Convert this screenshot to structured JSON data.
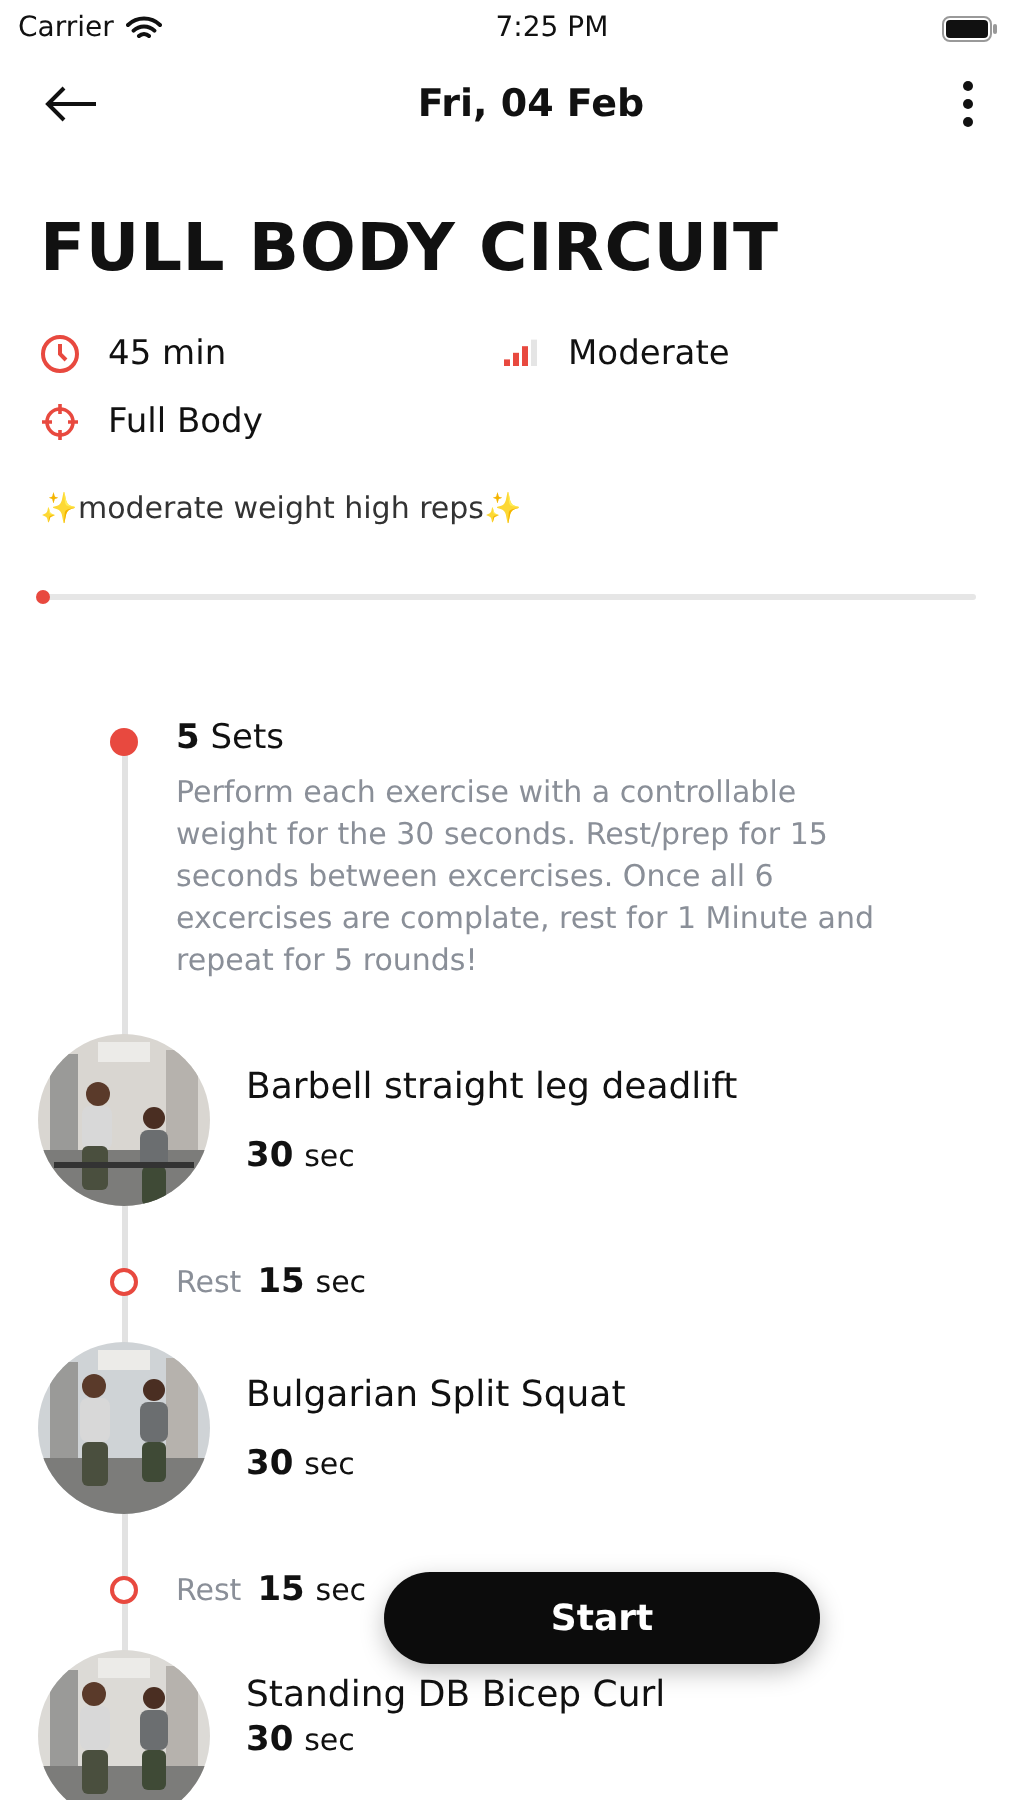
{
  "status_bar": {
    "carrier": "Carrier",
    "time": "7:25 PM"
  },
  "header": {
    "title": "Fri, 04 Feb"
  },
  "workout": {
    "title": "FULL BODY CIRCUIT",
    "meta": [
      {
        "kind": "duration",
        "text": "45 min"
      },
      {
        "kind": "difficulty",
        "text": "Moderate",
        "level": 0.75
      },
      {
        "kind": "focus",
        "text": "Full Body"
      }
    ],
    "tagline": "✨moderate weight high reps✨"
  },
  "progress": {
    "level": 0
  },
  "timeline": [
    {
      "kind": "set",
      "count": "5",
      "label": "Sets",
      "description": "Perform each exercise with a controllable weight for the 30 seconds. Rest/prep for 15 seconds between excercises. Once all 6 excercises are complate, rest for 1 Minute and repeat for 5 rounds!"
    },
    {
      "kind": "exercise",
      "name": "Barbell straight leg deadlift",
      "duration": "30",
      "unit": "sec"
    },
    {
      "kind": "rest",
      "label": "Rest",
      "duration": "15",
      "unit": "sec"
    },
    {
      "kind": "exercise",
      "name": "Bulgarian Split Squat",
      "duration": "30",
      "unit": "sec"
    },
    {
      "kind": "rest",
      "label": "Rest",
      "duration": "15",
      "unit": "sec"
    },
    {
      "kind": "exercise",
      "name": "Standing DB Bicep Curl",
      "duration": "30",
      "unit": "sec"
    }
  ],
  "start_button": {
    "label": "Start"
  }
}
